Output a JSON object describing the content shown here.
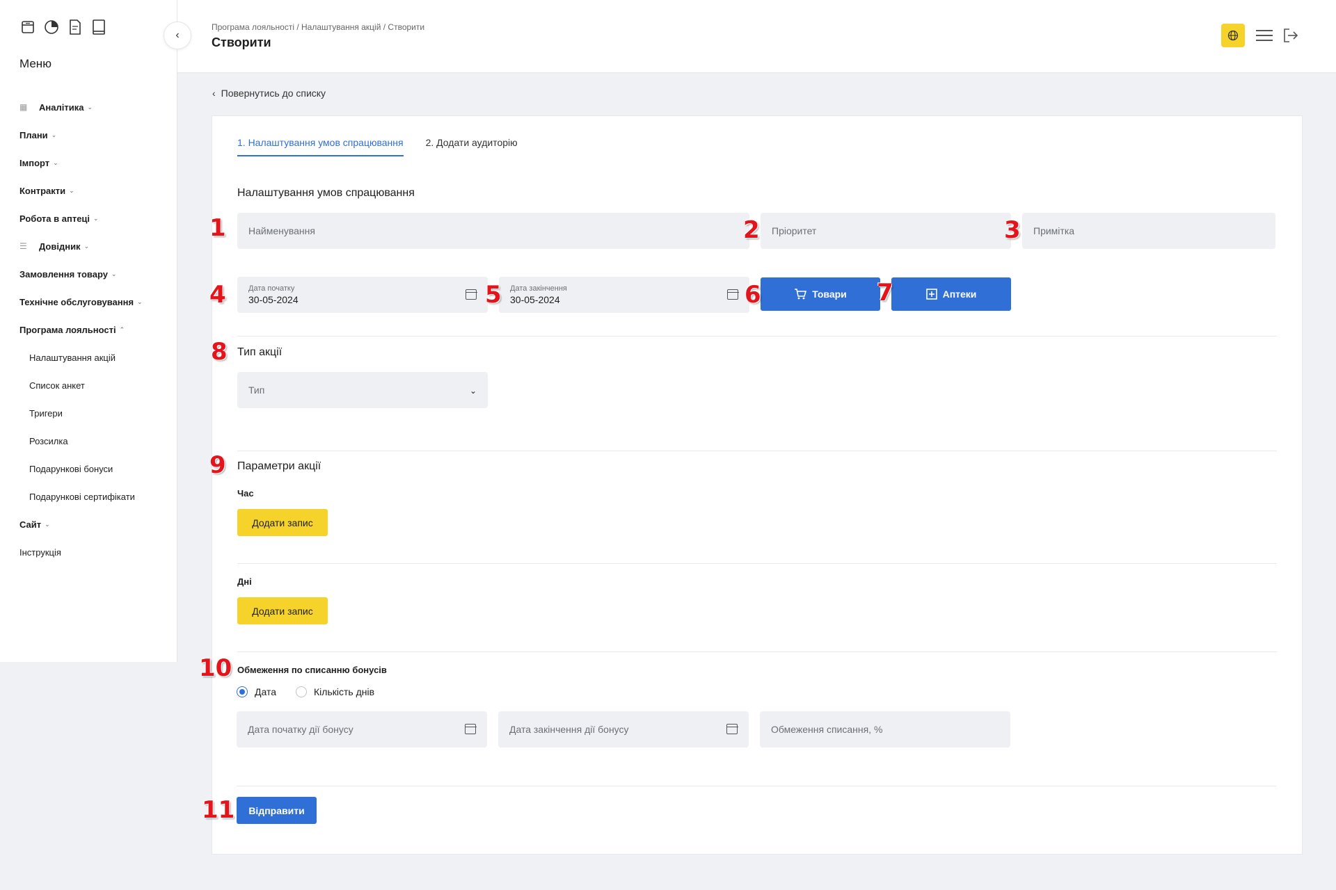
{
  "sidebar": {
    "menu_title": "Меню",
    "top_icons": [
      "archive-icon",
      "pie-chart-icon",
      "document-icon",
      "book-icon"
    ],
    "items": [
      {
        "label": "Аналітика",
        "icon": "grid-icon",
        "type": "group"
      },
      {
        "label": "Плани",
        "type": "group"
      },
      {
        "label": "Імпорт",
        "type": "group"
      },
      {
        "label": "Контракти",
        "type": "group"
      },
      {
        "label": "Робота в аптеці",
        "type": "group"
      },
      {
        "label": "Довідник",
        "icon": "list-icon",
        "type": "group"
      },
      {
        "label": "Замовлення товару",
        "type": "group"
      },
      {
        "label": "Технічне обслуговування",
        "type": "group"
      },
      {
        "label": "Програма лояльності",
        "type": "group-open"
      },
      {
        "label": "Налаштування акцій",
        "type": "sub"
      },
      {
        "label": "Список анкет",
        "type": "sub"
      },
      {
        "label": "Тригери",
        "type": "sub"
      },
      {
        "label": "Розсилка",
        "type": "sub"
      },
      {
        "label": "Подарункові бонуси",
        "type": "sub"
      },
      {
        "label": "Подарункові сертифікати",
        "type": "sub"
      },
      {
        "label": "Сайт",
        "type": "group"
      },
      {
        "label": "Інструкція",
        "type": "plain"
      }
    ]
  },
  "header": {
    "breadcrumb": "Програма лояльності / Налаштування акцій / Створити",
    "title": "Створити"
  },
  "back_link": "Повернутись до списку",
  "tabs": [
    {
      "label": "1. Налаштування умов спрацювання",
      "active": true
    },
    {
      "label": "2. Додати аудиторію",
      "active": false
    }
  ],
  "form": {
    "section_title": "Налаштування умов спрацювання",
    "name_placeholder": "Найменування",
    "priority_placeholder": "Пріоритет",
    "note_placeholder": "Примітка",
    "start_date_label": "Дата початку",
    "start_date_value": "30-05-2024",
    "end_date_label": "Дата закінчення",
    "end_date_value": "30-05-2024",
    "goods_button": "Товари",
    "pharmacies_button": "Аптеки",
    "type_section_title": "Тип акції",
    "type_placeholder": "Тип",
    "params_section_title": "Параметри акції",
    "time_label": "Час",
    "add_record_time": "Додати запис",
    "days_label": "Дні",
    "add_record_days": "Додати запис",
    "limit_title": "Обмеження по списанню бонусів",
    "radio_date": "Дата",
    "radio_days": "Кількість днів",
    "bonus_start_placeholder": "Дата початку дії бонусу",
    "bonus_end_placeholder": "Дата закінчення дії бонусу",
    "limit_percent_placeholder": "Обмеження списання, %",
    "submit_button": "Відправити"
  },
  "annotations": [
    "1",
    "2",
    "3",
    "4",
    "5",
    "6",
    "7",
    "8",
    "9",
    "10",
    "11"
  ],
  "colors": {
    "accent_blue": "#2f6fd6",
    "accent_yellow": "#f5d32a",
    "annotation_red": "#e3141b"
  }
}
